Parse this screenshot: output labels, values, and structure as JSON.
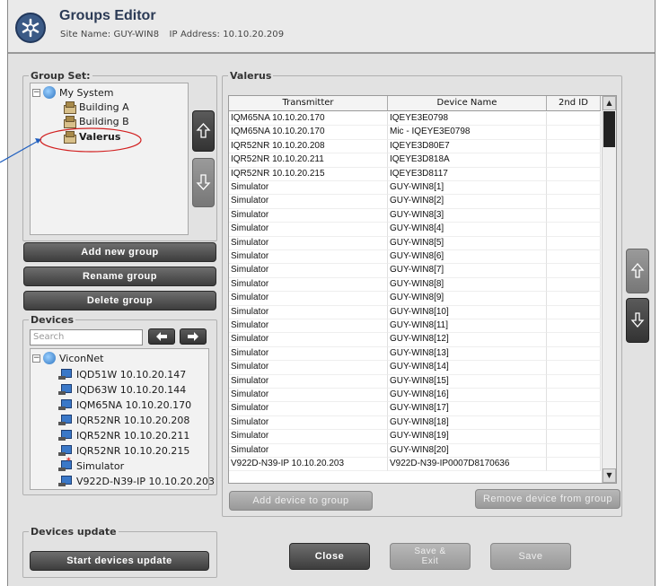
{
  "header": {
    "title": "Groups Editor",
    "site_label": "Site Name: GUY-WIN8",
    "ip_label": "IP Address: 10.10.20.209"
  },
  "group_set": {
    "legend": "Group Set:",
    "items": [
      {
        "label": "My System",
        "level": 0
      },
      {
        "label": "Building A",
        "level": 1
      },
      {
        "label": "Building B",
        "level": 1
      },
      {
        "label": "Valerus",
        "level": 1,
        "bold": true
      }
    ],
    "add_label": "Add new group",
    "rename_label": "Rename group",
    "delete_label": "Delete group"
  },
  "devices": {
    "legend": "Devices",
    "search_placeholder": "Search",
    "root": "ViconNet",
    "items": [
      "IQD51W 10.10.20.147",
      "IQD63W 10.10.20.144",
      "IQM65NA 10.10.20.170",
      "IQR52NR 10.10.20.208",
      "IQR52NR 10.10.20.211",
      "IQR52NR 10.10.20.215",
      "Simulator",
      "V922D-N39-IP 10.10.20.203"
    ]
  },
  "group_panel": {
    "legend": "Valerus",
    "columns": [
      "Transmitter",
      "Device Name",
      "2nd ID"
    ],
    "rows": [
      [
        "IQM65NA 10.10.20.170",
        "IQEYE3E0798",
        ""
      ],
      [
        "IQM65NA 10.10.20.170",
        "Mic - IQEYE3E0798",
        ""
      ],
      [
        "IQR52NR 10.10.20.208",
        "IQEYE3D80E7",
        ""
      ],
      [
        "IQR52NR 10.10.20.211",
        "IQEYE3D818A",
        ""
      ],
      [
        "IQR52NR 10.10.20.215",
        "IQEYE3D8117",
        ""
      ],
      [
        "Simulator",
        "GUY-WIN8[1]",
        ""
      ],
      [
        "Simulator",
        "GUY-WIN8[2]",
        ""
      ],
      [
        "Simulator",
        "GUY-WIN8[3]",
        ""
      ],
      [
        "Simulator",
        "GUY-WIN8[4]",
        ""
      ],
      [
        "Simulator",
        "GUY-WIN8[5]",
        ""
      ],
      [
        "Simulator",
        "GUY-WIN8[6]",
        ""
      ],
      [
        "Simulator",
        "GUY-WIN8[7]",
        ""
      ],
      [
        "Simulator",
        "GUY-WIN8[8]",
        ""
      ],
      [
        "Simulator",
        "GUY-WIN8[9]",
        ""
      ],
      [
        "Simulator",
        "GUY-WIN8[10]",
        ""
      ],
      [
        "Simulator",
        "GUY-WIN8[11]",
        ""
      ],
      [
        "Simulator",
        "GUY-WIN8[12]",
        ""
      ],
      [
        "Simulator",
        "GUY-WIN8[13]",
        ""
      ],
      [
        "Simulator",
        "GUY-WIN8[14]",
        ""
      ],
      [
        "Simulator",
        "GUY-WIN8[15]",
        ""
      ],
      [
        "Simulator",
        "GUY-WIN8[16]",
        ""
      ],
      [
        "Simulator",
        "GUY-WIN8[17]",
        ""
      ],
      [
        "Simulator",
        "GUY-WIN8[18]",
        ""
      ],
      [
        "Simulator",
        "GUY-WIN8[19]",
        ""
      ],
      [
        "Simulator",
        "GUY-WIN8[20]",
        ""
      ],
      [
        "V922D-N39-IP 10.10.20.203",
        "V922D-N39-IP0007D8170636",
        ""
      ]
    ],
    "add_device_label": "Add device to group",
    "remove_device_label": "Remove device from group"
  },
  "devices_update": {
    "legend": "Devices update",
    "start_label": "Start devices update"
  },
  "footer": {
    "close_label": "Close",
    "save_exit_label_1": "Save &",
    "save_exit_label_2": "Exit",
    "save_label": "Save"
  },
  "colors": {
    "annotation": "#1f5fbf",
    "highlight_ellipse": "#d22020"
  }
}
